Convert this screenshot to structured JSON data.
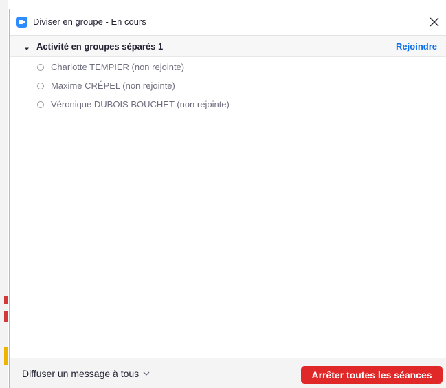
{
  "window": {
    "title": "Diviser en groupe - En cours",
    "icons": {
      "app": "zoom-camera-icon",
      "close": "close-icon"
    }
  },
  "group": {
    "name": "Activité en groupes séparés 1",
    "join_label": "Rejoindre",
    "expanded": true,
    "participants": [
      {
        "name": "Charlotte TEMPIER (non rejointe)"
      },
      {
        "name": "Maxime CRÉPEL (non rejointe)"
      },
      {
        "name": "Véronique DUBOIS BOUCHET (non rejointe)"
      }
    ]
  },
  "footer": {
    "broadcast_label": "Diffuser un message à tous",
    "stop_label": "Arrêter toutes les séances"
  },
  "colors": {
    "accent": "#2d8cff",
    "link": "#0e72ed",
    "danger": "#e02828"
  }
}
